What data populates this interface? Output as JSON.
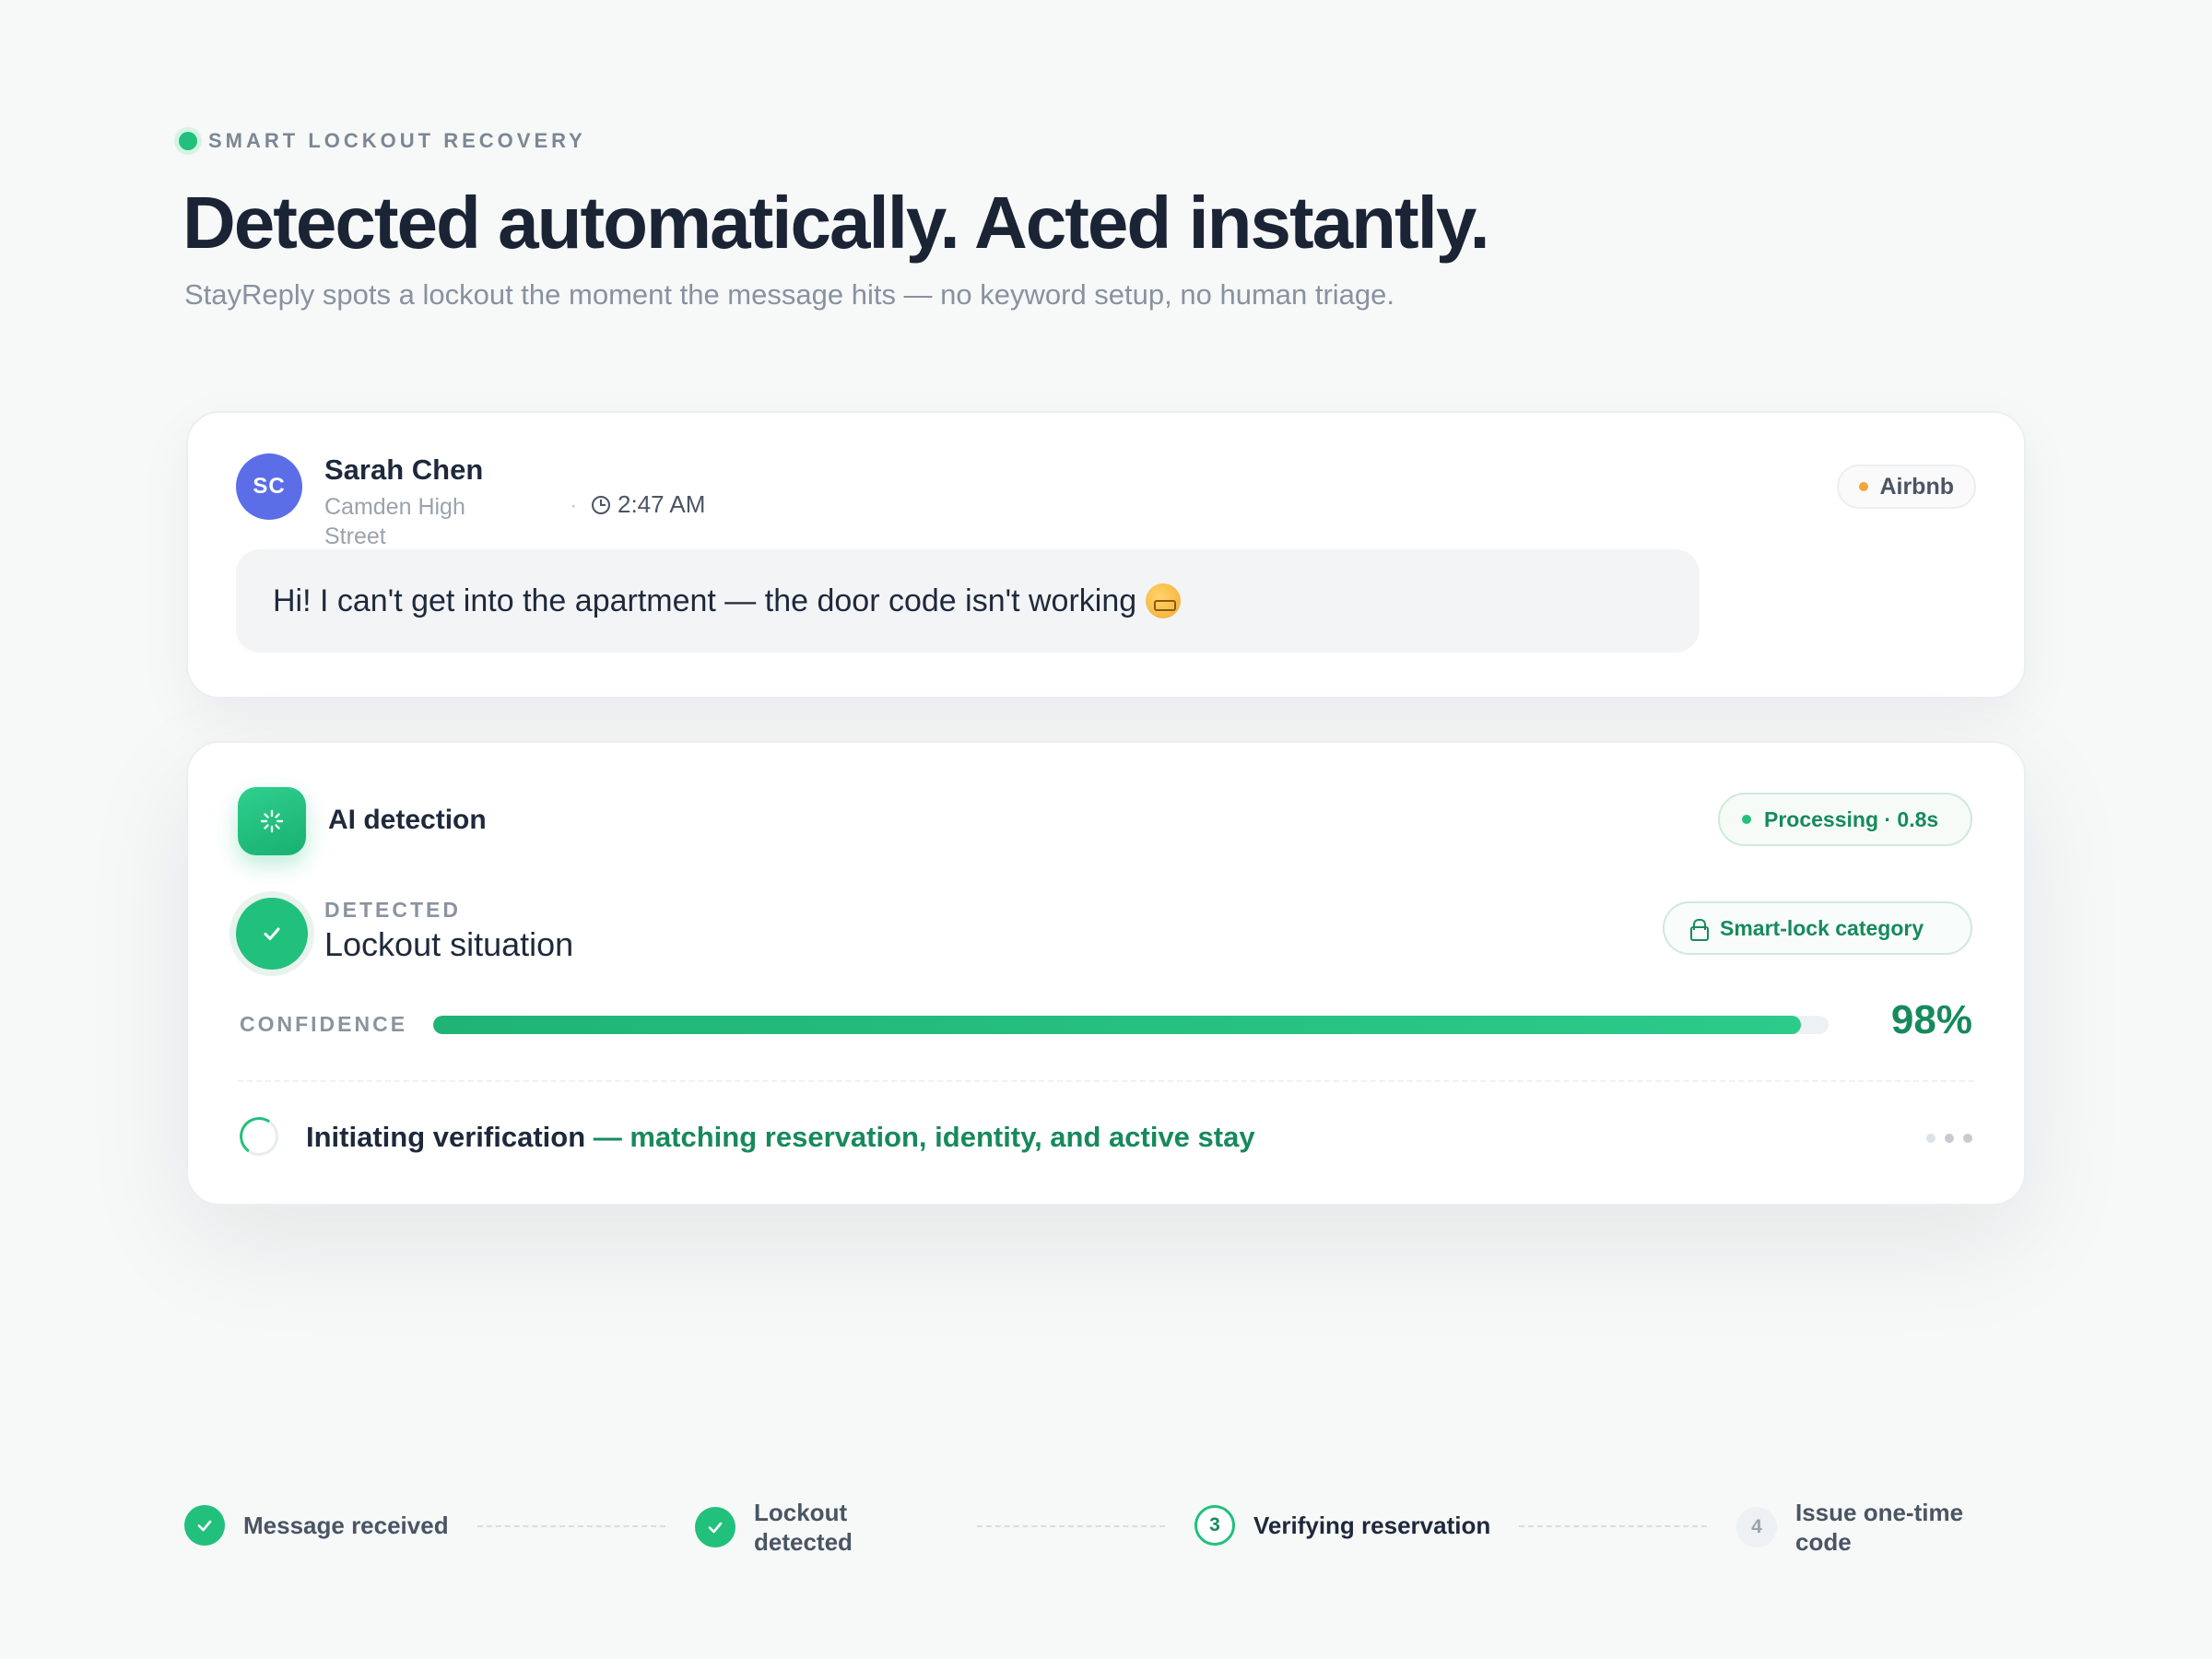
{
  "header": {
    "eyebrow": "SMART LOCKOUT RECOVERY",
    "headline": "Detected automatically. Acted instantly.",
    "subhead": "StayReply spots a lockout the moment the message hits — no keyword setup, no human triage."
  },
  "message": {
    "avatar_initials": "SC",
    "sender_name": "Sarah Chen",
    "location": "Camden High Street",
    "separator": "·",
    "time": "2:47 AM",
    "channel": "Airbnb",
    "text": "Hi! I can't get into the apartment — the door code isn't working"
  },
  "ai": {
    "title": "AI detection",
    "status": "Processing · 0.8s",
    "detected_label": "DETECTED",
    "detected_value": "Lockout situation",
    "category": "Smart-lock category",
    "confidence_label": "CONFIDENCE",
    "confidence_value": "98%",
    "confidence_fraction": 0.98,
    "verify_main": "Initiating verification",
    "verify_detail": " — matching reservation, identity, and active stay"
  },
  "steps": [
    {
      "label": "Message received",
      "state": "done"
    },
    {
      "label": "Lockout detected",
      "state": "done"
    },
    {
      "number": "3",
      "label": "Verifying reservation",
      "state": "active"
    },
    {
      "number": "4",
      "label": "Issue one-time code",
      "state": "pending"
    }
  ],
  "colors": {
    "accent": "#22c07d",
    "accent_dark": "#178a5c",
    "avatar": "#5b6ee8",
    "channel_dot": "#f0a73a"
  }
}
